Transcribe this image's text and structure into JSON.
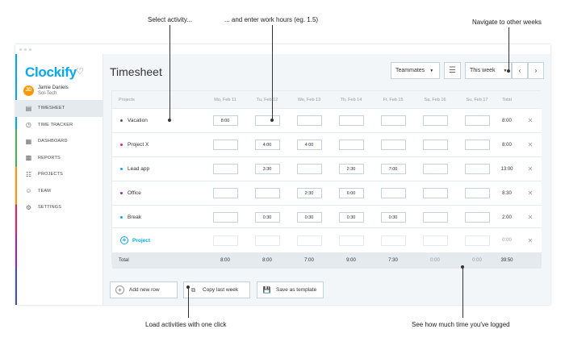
{
  "annotations": {
    "select": "Select activity...",
    "enter": "... and enter work hours (eg. 1.5)",
    "navigate": "Navigate to other weeks",
    "load": "Load activities with one click",
    "see": "See how much time you've logged"
  },
  "sidebar": {
    "logo": "Clockify",
    "user": {
      "initials": "JD",
      "name": "Jamie Daniels",
      "org": "Sol-Tech"
    },
    "items": [
      {
        "label": "TIMESHEET",
        "icon": "timesheet-icon",
        "active": true
      },
      {
        "label": "TIME TRACKER",
        "icon": "clock-icon"
      },
      {
        "label": "DASHBOARD",
        "icon": "dashboard-icon"
      },
      {
        "label": "REPORTS",
        "icon": "reports-icon"
      },
      {
        "label": "PROJECTS",
        "icon": "projects-icon"
      },
      {
        "label": "TEAM",
        "icon": "team-icon"
      },
      {
        "label": "SETTINGS",
        "icon": "settings-icon"
      }
    ]
  },
  "header": {
    "title": "Timesheet",
    "teammates": "Teammates",
    "week": "This week"
  },
  "table": {
    "projects_label": "Projects",
    "total_label": "Total",
    "days": [
      "Mo, Feb 11",
      "Tu, Feb 12",
      "We, Feb 13",
      "Th, Feb 14",
      "Fr, Feb 15",
      "Sa, Feb 16",
      "Su, Feb 17"
    ],
    "rows": [
      {
        "name": "Vacation",
        "color": "#555555",
        "hours": [
          "8:00",
          "",
          "",
          "",
          "",
          "",
          ""
        ],
        "total": "8:00"
      },
      {
        "name": "Project X",
        "color": "#e91e63",
        "hours": [
          "",
          "4:00",
          "4:00",
          "",
          "",
          "",
          ""
        ],
        "total": "8:00"
      },
      {
        "name": "Lead app",
        "color": "#03a9f4",
        "hours": [
          "",
          "3:30",
          "",
          "2:30",
          "7:00",
          "",
          ""
        ],
        "total": "13:00"
      },
      {
        "name": "Office",
        "color": "#9c27b0",
        "hours": [
          "",
          "",
          "2:30",
          "6:00",
          "",
          "",
          ""
        ],
        "total": "8:30"
      },
      {
        "name": "Break",
        "color": "#03a9f4",
        "hours": [
          "",
          "0:30",
          "0:30",
          "0:30",
          "0:30",
          "",
          ""
        ],
        "total": "2:00"
      }
    ],
    "add_project": {
      "label": "Project",
      "total": "0:00"
    },
    "totals": {
      "label": "Total",
      "values": [
        "8:00",
        "8:00",
        "7:00",
        "9:00",
        "7:30",
        "0:00",
        "0:00"
      ],
      "grand": "39:50"
    }
  },
  "actions": {
    "add_row": "Add new row",
    "copy_week": "Copy last week",
    "save_template": "Save as template"
  }
}
